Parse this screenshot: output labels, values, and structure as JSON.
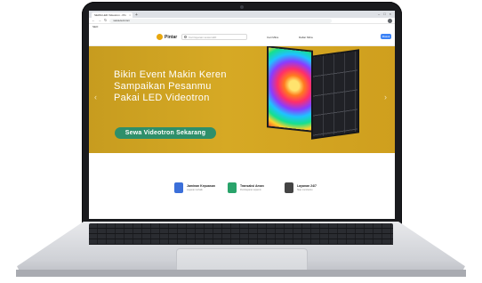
{
  "browser": {
    "tab_title": "SEWA LED Videotron - Pin",
    "tab_close": "×",
    "new_tab": "+",
    "window_controls": [
      "–",
      "□",
      "×"
    ],
    "url": "sewa-led.com",
    "bookmarks_label": "SEO"
  },
  "site": {
    "logo_text": "Pintar",
    "search_placeholder": "Cari layanan sewa LED",
    "links": [
      "Cari Mitra",
      "Daftar Mitra"
    ],
    "login_button": "Masuk"
  },
  "hero": {
    "lines": [
      "Bikin Event Makin Keren",
      "Sampaikan Pesanmu",
      "Pakai LED Videotron"
    ],
    "cta_label": "Sewa Videotron Sekarang",
    "arrow_left": "‹",
    "arrow_right": "›"
  },
  "features": [
    {
      "title": "Jaminan Kepuasan",
      "desc": "Layanan terbaik",
      "icon": "gift-icon",
      "color": "#3b6fd9"
    },
    {
      "title": "Transaksi Aman",
      "desc": "Pembayaran terjamin",
      "icon": "shield-check-icon",
      "color": "#29a36a"
    },
    {
      "title": "Layanan 24/7",
      "desc": "Siap membantu",
      "icon": "headset-icon",
      "color": "#444444"
    }
  ],
  "colors": {
    "hero_gold": "#d6a924",
    "cta_green": "#2e8f6a",
    "button_blue": "#3b82f6"
  }
}
